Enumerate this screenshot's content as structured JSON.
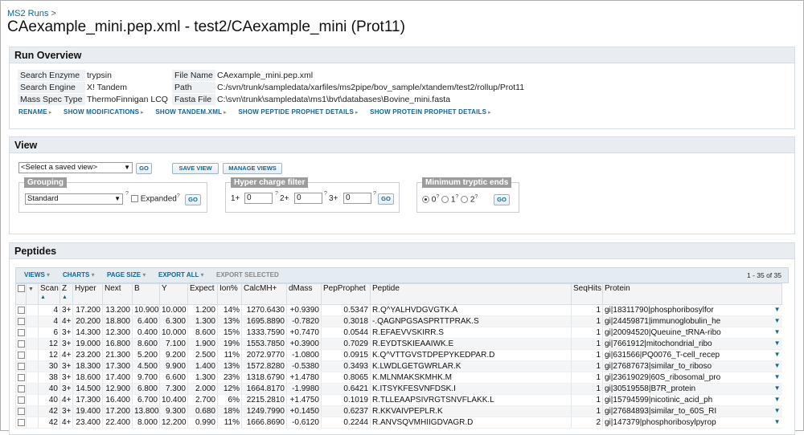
{
  "breadcrumb": {
    "label": "MS2 Runs",
    "sep": ">"
  },
  "title": "CAexample_mini.pep.xml - test2/CAexample_mini (Prot11)",
  "overview": {
    "title": "Run Overview",
    "left": [
      {
        "k": "Search Enzyme",
        "v": "trypsin"
      },
      {
        "k": "Search Engine",
        "v": "X! Tandem"
      },
      {
        "k": "Mass Spec Type",
        "v": "ThermoFinnigan LCQ"
      }
    ],
    "right": [
      {
        "k": "File Name",
        "v": "CAexample_mini.pep.xml"
      },
      {
        "k": "Path",
        "v": "C:/svn/trunk/sampledata/xarfiles/ms2pipe/bov_sample/xtandem/test2/rollup/Prot11"
      },
      {
        "k": "Fasta File",
        "v": "C:\\svn\\trunk\\sampledata\\ms1\\bvt\\databases\\Bovine_mini.fasta"
      }
    ],
    "links": [
      "RENAME",
      "SHOW MODIFICATIONS",
      "SHOW TANDEM.XML",
      "SHOW PEPTIDE PROPHET DETAILS",
      "SHOW PROTEIN PROPHET DETAILS"
    ]
  },
  "view": {
    "title": "View",
    "saved_view": "<Select a saved view>",
    "go": "GO",
    "save_view": "SAVE VIEW",
    "manage_views": "MANAGE VIEWS",
    "grouping": {
      "legend": "Grouping",
      "value": "Standard",
      "q": "?",
      "expanded": "Expanded",
      "q2": "?"
    },
    "charge": {
      "legend": "Hyper charge filter",
      "c1": "1+",
      "c2": "2+",
      "c3": "3+",
      "v1": "0",
      "v2": "0",
      "v3": "0",
      "q": "?"
    },
    "tryptic": {
      "legend": "Minimum tryptic ends",
      "o0": "0",
      "o1": "1",
      "o2": "2",
      "q": "?",
      "selected": 0
    }
  },
  "peptides": {
    "title": "Peptides",
    "menus": [
      "VIEWS",
      "CHARTS",
      "PAGE SIZE",
      "EXPORT ALL"
    ],
    "export_selected": "EXPORT SELECTED",
    "count": "1 - 35 of 35",
    "columns": [
      "Scan",
      "Z",
      "Hyper",
      "Next",
      "B",
      "Y",
      "Expect",
      "Ion%",
      "CalcMH+",
      "dMass",
      "PepProphet",
      "Peptide",
      "SeqHits",
      "Protein"
    ],
    "rows": [
      [
        "4",
        "3+",
        "17.200",
        "13.200",
        "10.900",
        "10.000",
        "1.200",
        "14%",
        "1270.6430",
        "+0.9390",
        "0.5347",
        "R.Q^YALHVDGVGTK.A",
        "1",
        "gi|18311790|phosphoribosylfor"
      ],
      [
        "4",
        "4+",
        "20.200",
        "18.800",
        "6.400",
        "6.300",
        "1.300",
        "13%",
        "1695.8890",
        "-0.7820",
        "0.3018",
        "-.QAGNPGSASPRTTPRAK.S",
        "1",
        "gi|24459871|immunoglobulin_he"
      ],
      [
        "6",
        "3+",
        "14.300",
        "12.300",
        "0.400",
        "10.000",
        "8.600",
        "15%",
        "1333.7590",
        "+0.7470",
        "0.0544",
        "R.EFAEVVSKIRR.S",
        "1",
        "gi|20094520|Queuine_tRNA-ribo"
      ],
      [
        "12",
        "3+",
        "19.000",
        "16.800",
        "8.600",
        "7.100",
        "1.900",
        "19%",
        "1553.7850",
        "+0.3900",
        "0.7029",
        "R.EYDTSKIEAAIWK.E",
        "1",
        "gi|7661912|mitochondrial_ribo"
      ],
      [
        "12",
        "4+",
        "23.200",
        "21.300",
        "5.200",
        "9.200",
        "2.500",
        "11%",
        "2072.9770",
        "-1.0800",
        "0.0915",
        "K.Q^VTTGVSTDPEPYKEDPAR.D",
        "1",
        "gi|631566|PQ0076_T-cell_recep"
      ],
      [
        "30",
        "3+",
        "18.300",
        "17.300",
        "4.500",
        "9.900",
        "1.400",
        "13%",
        "1572.8280",
        "-0.5380",
        "0.3493",
        "K.LWDLGETGWRLAR.K",
        "1",
        "gi|27687673|similar_to_riboso"
      ],
      [
        "38",
        "3+",
        "18.600",
        "17.400",
        "9.700",
        "6.600",
        "1.300",
        "23%",
        "1318.6790",
        "+1.4780",
        "0.8065",
        "K.MLNMAKSKMHK.M",
        "1",
        "gi|23619029|60S_ribosomal_pro"
      ],
      [
        "40",
        "3+",
        "14.500",
        "12.900",
        "6.800",
        "7.300",
        "2.000",
        "12%",
        "1664.8170",
        "-1.9980",
        "0.6421",
        "K.ITSYKFESVNFDSK.I",
        "1",
        "gi|30519558|B7R_protein"
      ],
      [
        "40",
        "4+",
        "17.300",
        "16.400",
        "6.700",
        "10.400",
        "2.700",
        "6%",
        "2215.2810",
        "+1.4750",
        "0.1019",
        "R.TLLEAAPSIVRGTSNVFLAKK.L",
        "1",
        "gi|15794599|nicotinic_acid_ph"
      ],
      [
        "42",
        "3+",
        "19.400",
        "17.200",
        "13.800",
        "9.300",
        "0.680",
        "18%",
        "1249.7990",
        "+0.1450",
        "0.6237",
        "R.KKVAIVPEPLR.K",
        "1",
        "gi|27684893|similar_to_60S_RI"
      ],
      [
        "42",
        "4+",
        "23.400",
        "22.400",
        "8.000",
        "12.200",
        "0.990",
        "11%",
        "1666.8690",
        "-0.6120",
        "0.2244",
        "R.ANVSQVMHIIGDVAGR.D",
        "2",
        "gi|147379|phosphoribosylpyrop"
      ]
    ]
  }
}
